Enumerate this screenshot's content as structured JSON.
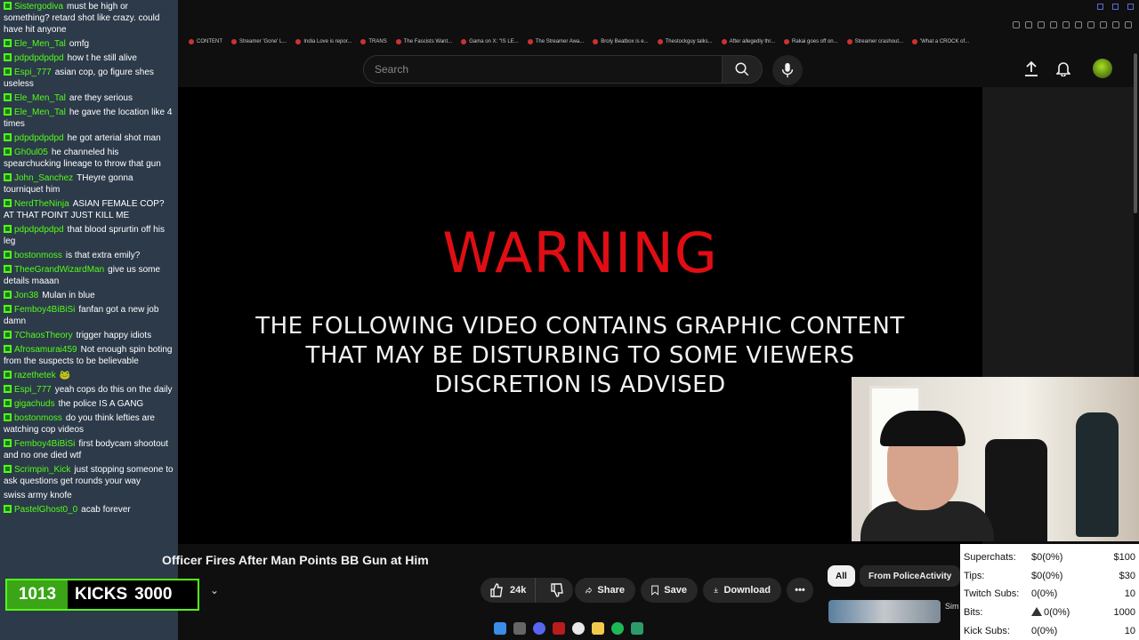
{
  "chat": {
    "messages": [
      {
        "user": "Sistergodiva",
        "text": "must be high or something? retard shot like crazy. could have hit anyone"
      },
      {
        "user": "Ele_Men_Tal",
        "text": "omfg"
      },
      {
        "user": "pdpdpdpdpd",
        "text": "how t he still alive"
      },
      {
        "user": "Espi_777",
        "text": "asian cop, go figure shes useless"
      },
      {
        "user": "Ele_Men_Tal",
        "text": "are they serious"
      },
      {
        "user": "Ele_Men_Tal",
        "text": "he gave the location like 4 times"
      },
      {
        "user": "pdpdpdpdpd",
        "text": "he got arterial shot man"
      },
      {
        "user": "Gh0ul05",
        "text": "he channeled his spearchucking lineage to throw that gun"
      },
      {
        "user": "John_Sanchez",
        "text": "THeyre gonna tourniquet him"
      },
      {
        "user": "NerdTheNinja",
        "text": "ASIAN FEMALE COP? AT THAT POINT JUST KILL ME"
      },
      {
        "user": "pdpdpdpdpd",
        "text": "that blood sprurtin off his leg"
      },
      {
        "user": "bostonmoss",
        "text": "is that extra emily?"
      },
      {
        "user": "TheeGrandWizardMan",
        "text": "give us some details maaan"
      },
      {
        "user": "Jon38",
        "text": "Mulan in blue"
      },
      {
        "user": "Femboy4BiBiSi",
        "text": "fanfan got a new job damn"
      },
      {
        "user": "7ChaosTheory",
        "text": "trigger happy idiots"
      },
      {
        "user": "Afrosamurai459",
        "text": "Not enough spin boting from the suspects to be believable"
      },
      {
        "user": "razethetek",
        "text": "🐸"
      },
      {
        "user": "Espi_777",
        "text": "yeah cops do this on the daily"
      },
      {
        "user": "gigachuds",
        "text": "the police IS A GANG"
      },
      {
        "user": "bostonmoss",
        "text": "do you think lefties are watching cop videos"
      },
      {
        "user": "Femboy4BiBiSi",
        "text": "first bodycam shootout and no one died wtf"
      },
      {
        "user": "Scrimpin_Kick",
        "text": "just stopping someone to ask questions get rounds your way"
      },
      {
        "user": "",
        "text": "swiss army knofe"
      },
      {
        "user": "PastelGhost0_0",
        "text": "acab forever"
      }
    ]
  },
  "bookmarks": [
    "CONTENT",
    "Streamer 'Gone' L...",
    "India Love is repor...",
    "TRANS",
    "The Fascists Want...",
    "Gama on X: \"IS LE...",
    "The Streamer Awa...",
    "Broly Beatbox is e...",
    "Thestockguy talks...",
    "After allegedly thr...",
    "Rakai goes off on...",
    "Streamer crashout...",
    "'What a CROCK of..."
  ],
  "youtube": {
    "search_placeholder": "Search",
    "video": {
      "warning_title": "WARNING",
      "warning_line1": "THE FOLLOWING VIDEO CONTAINS GRAPHIC CONTENT",
      "warning_line2": "THAT MAY BE DISTURBING TO SOME VIEWERS",
      "warning_line3": "DISCRETION IS ADVISED"
    },
    "title": "Officer Fires After Man Points BB Gun at Him",
    "likes": "24k",
    "share_label": "Share",
    "save_label": "Save",
    "download_label": "Download",
    "chips": {
      "all": "All",
      "from": "From PoliceActivity"
    },
    "related_title_fragment": "Sim"
  },
  "kicks": {
    "count": "1013",
    "label": "KICKS",
    "goal": "3000"
  },
  "stats": [
    {
      "label": "Superchats:",
      "value": "$0(0%)",
      "goal": "$100"
    },
    {
      "label": "Tips:",
      "value": "$0(0%)",
      "goal": "$30"
    },
    {
      "label": "Twitch Subs:",
      "value": "0(0%)",
      "goal": "10"
    },
    {
      "label": "Bits:",
      "value": "0(0%)",
      "goal": "1000"
    },
    {
      "label": "Kick Subs:",
      "value": "0(0%)",
      "goal": "10"
    }
  ],
  "colors": {
    "kick_green": "#53fc18",
    "warning_red": "#e00e14",
    "chat_bg": "#2c3a4a"
  }
}
